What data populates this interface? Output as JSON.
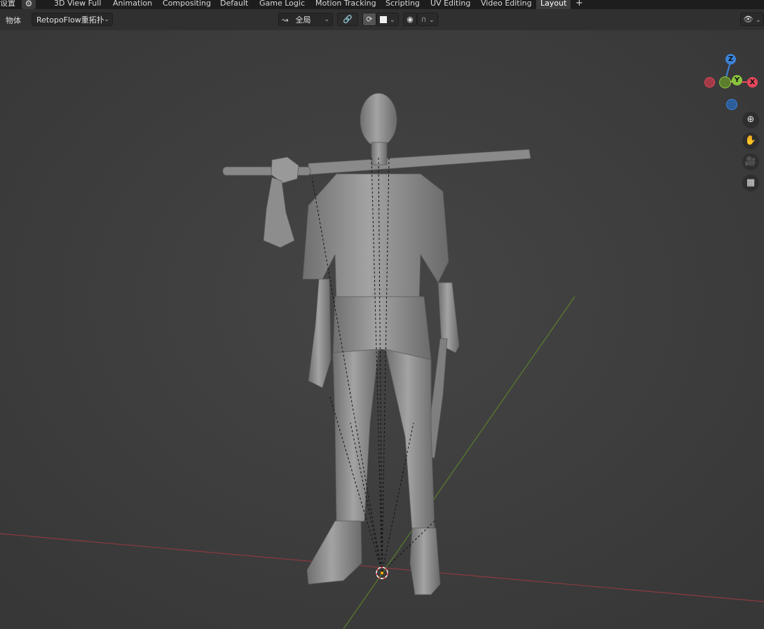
{
  "topbar": {
    "settings_label": "设置",
    "tabs": [
      {
        "label": "3D View Full"
      },
      {
        "label": "Animation"
      },
      {
        "label": "Compositing"
      },
      {
        "label": "Default"
      },
      {
        "label": "Game Logic"
      },
      {
        "label": "Motion Tracking"
      },
      {
        "label": "Scripting"
      },
      {
        "label": "UV Editing"
      },
      {
        "label": "Video Editing"
      },
      {
        "label": "Layout",
        "active": true
      }
    ],
    "add_tab_label": "+"
  },
  "header": {
    "mode_label": "物体",
    "addon_dropdown": "RetopoFlow重拓扑",
    "transform_orientation": "全局"
  },
  "gizmo": {
    "z_label": "Z",
    "y_label": "Y",
    "x_label": "X",
    "x_color": "#e8485c",
    "y_color": "#8ac43d",
    "z_color": "#3c82d8"
  },
  "nav_tools": [
    "zoom-icon",
    "hand-icon",
    "camera-icon",
    "grid-icon"
  ],
  "scene": {
    "x_axis_color": "#8b3a3f",
    "y_axis_color": "#5b7d2d",
    "model_color": "#8c8c8c"
  }
}
